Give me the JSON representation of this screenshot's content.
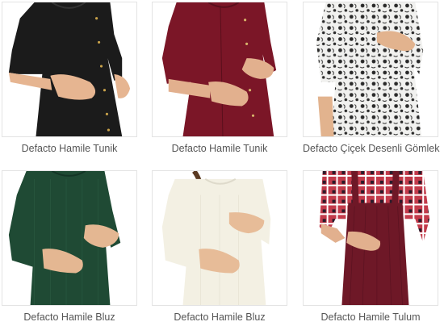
{
  "products": [
    {
      "name": "Defacto Hamile Tunik",
      "garment_color": "#1b1b1b",
      "skin_color": "#e6b591"
    },
    {
      "name": "Defacto Hamile Tunik",
      "garment_color": "#7b1627",
      "skin_color": "#e2b08e"
    },
    {
      "name": "Defacto Çiçek Desenli Gömlek",
      "garment_color": "#f1f1ef",
      "pattern_color": "#2a2a2a",
      "skin_color": "#e2b38e"
    },
    {
      "name": "Defacto Hamile Bluz",
      "garment_color": "#1f4a34",
      "skin_color": "#e4b792"
    },
    {
      "name": "Defacto Hamile Bluz",
      "garment_color": "#f3f0e3",
      "skin_color": "#e7bc98"
    },
    {
      "name": "Defacto Hamile Tulum",
      "garment_color": "#6e1827",
      "shirt_color": "#c23a4a",
      "skin_color": "#e2b08e"
    }
  ]
}
